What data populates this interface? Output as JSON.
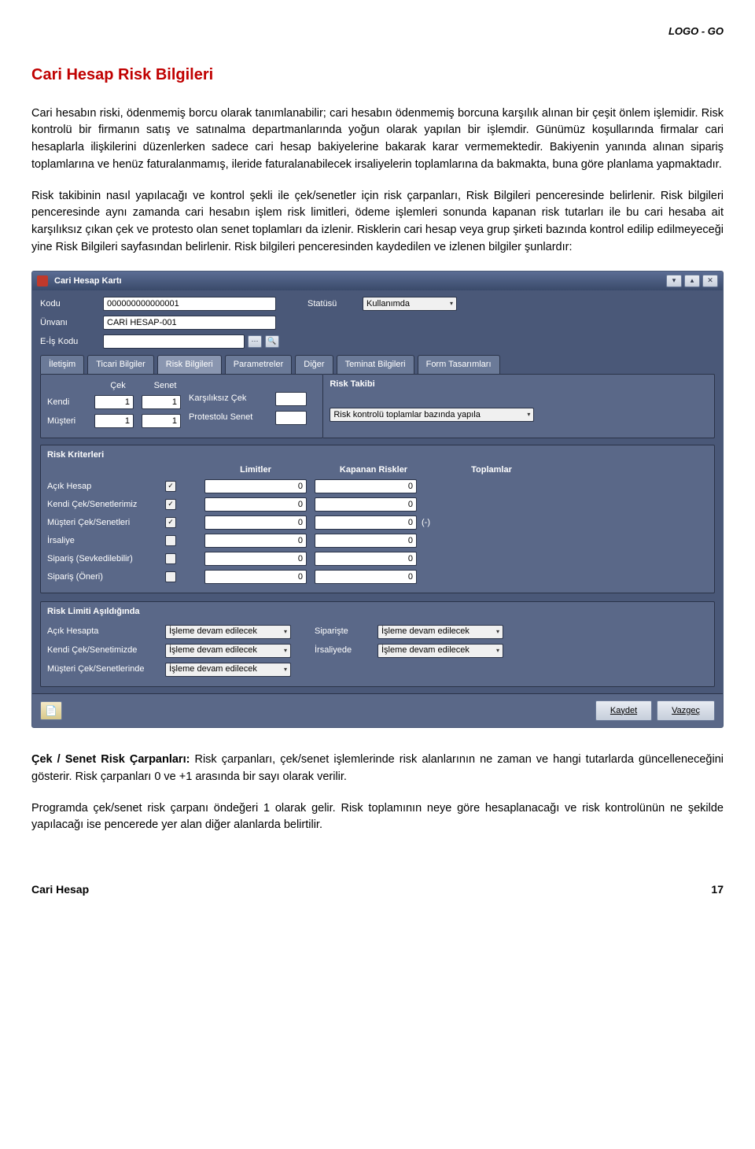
{
  "header": {
    "logo": "LOGO - GO"
  },
  "title": "Cari Hesap Risk Bilgileri",
  "paragraphs": {
    "p1": "Cari hesabın riski, ödenmemiş borcu olarak tanımlanabilir; cari hesabın ödenmemiş borcuna karşılık alınan bir çeşit önlem işlemidir. Risk kontrolü bir firmanın satış ve satınalma departmanlarında yoğun olarak yapılan bir işlemdir. Günümüz koşullarında firmalar cari hesaplarla ilişkilerini düzenlerken sadece cari hesap bakiyelerine bakarak karar vermemektedir. Bakiyenin yanında alınan sipariş toplamlarına ve henüz faturalanmamış, ileride faturalanabilecek irsaliyelerin toplamlarına da bakmakta, buna göre planlama yapmaktadır.",
    "p2": "Risk takibinin nasıl yapılacağı ve kontrol şekli ile çek/senetler için risk çarpanları, Risk Bilgileri penceresinde belirlenir. Risk bilgileri penceresinde aynı zamanda cari hesabın işlem risk limitleri, ödeme işlemleri sonunda kapanan risk tutarları ile bu cari hesaba ait karşılıksız çıkan çek ve protesto olan senet toplamları da izlenir. Risklerin cari hesap veya grup şirketi bazında kontrol edilip edilmeyeceği yine Risk Bilgileri sayfasından belirlenir. Risk bilgileri penceresinden kaydedilen ve izlenen bilgiler şunlardır:",
    "p3_bold": "Çek / Senet Risk Çarpanları:",
    "p3_rest": " Risk çarpanları, çek/senet işlemlerinde risk alanlarının ne zaman ve hangi tutarlarda güncelleneceğini gösterir. Risk çarpanları 0 ve +1 arasında bir sayı olarak verilir.",
    "p4": "Programda çek/senet risk çarpanı öndeğeri 1 olarak gelir. Risk toplamının neye göre hesaplanacağı ve risk kontrolünün ne şekilde yapılacağı ise pencerede yer alan diğer alanlarda belirtilir."
  },
  "window": {
    "title": "Cari Hesap Kartı",
    "fields": {
      "kodu_label": "Kodu",
      "kodu_value": "000000000000001",
      "statusu_label": "Statüsü",
      "statusu_value": "Kullanımda",
      "unvani_label": "Ünvanı",
      "unvani_value": "CARİ HESAP-001",
      "eis_label": "E-İş Kodu"
    },
    "tabs": [
      "İletişim",
      "Ticari Bilgiler",
      "Risk Bilgileri",
      "Parametreler",
      "Diğer",
      "Teminat Bilgileri",
      "Form Tasarımları"
    ],
    "cek_senet": {
      "cek_hdr": "Çek",
      "senet_hdr": "Senet",
      "kendi_label": "Kendi",
      "musteri_label": "Müşteri",
      "kendi_cek": "1",
      "kendi_senet": "1",
      "musteri_cek": "1",
      "musteri_senet": "1",
      "karsiliksiz_label": "Karşılıksız Çek",
      "protestolu_label": "Protestolu Senet"
    },
    "risk_takibi": {
      "title": "Risk Takibi",
      "kontrol_value": "Risk kontrolü toplamlar bazında yapıla"
    },
    "risk_kriterleri": {
      "title": "Risk Kriterleri",
      "hdr_limitler": "Limitler",
      "hdr_kapanan": "Kapanan Riskler",
      "hdr_toplamlar": "Toplamlar",
      "rows": [
        {
          "label": "Açık Hesap",
          "checked": true,
          "limit": "0",
          "kapanan": "0"
        },
        {
          "label": "Kendi Çek/Senetlerimiz",
          "checked": true,
          "limit": "0",
          "kapanan": "0"
        },
        {
          "label": "Müşteri Çek/Senetleri",
          "checked": true,
          "limit": "0",
          "kapanan": "0",
          "suffix": "(-)"
        },
        {
          "label": "İrsaliye",
          "checked": false,
          "limit": "0",
          "kapanan": "0"
        },
        {
          "label": "Sipariş (Sevkedilebilir)",
          "checked": false,
          "limit": "0",
          "kapanan": "0"
        },
        {
          "label": "Sipariş (Öneri)",
          "checked": false,
          "limit": "0",
          "kapanan": "0"
        }
      ]
    },
    "risk_limiti": {
      "title": "Risk Limiti Aşıldığında",
      "rows": [
        {
          "l1": "Açık Hesapta",
          "v1": "İşleme devam edilecek",
          "l2": "Siparişte",
          "v2": "İşleme devam edilecek"
        },
        {
          "l1": "Kendi Çek/Senetimizde",
          "v1": "İşleme devam edilecek",
          "l2": "İrsaliyede",
          "v2": "İşleme devam edilecek"
        },
        {
          "l1": "Müşteri Çek/Senetlerinde",
          "v1": "İşleme devam edilecek"
        }
      ]
    },
    "footer": {
      "kaydet": "Kaydet",
      "vazgec": "Vazgeç"
    }
  },
  "page_footer": {
    "left": "Cari Hesap",
    "num": "17"
  }
}
